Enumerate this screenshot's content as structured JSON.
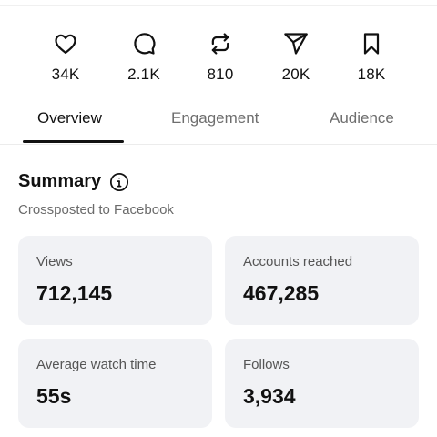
{
  "engagement_stats": [
    {
      "icon": "heart-icon",
      "value": "34K"
    },
    {
      "icon": "comment-icon",
      "value": "2.1K"
    },
    {
      "icon": "repost-icon",
      "value": "810"
    },
    {
      "icon": "share-icon",
      "value": "20K"
    },
    {
      "icon": "bookmark-icon",
      "value": "18K"
    }
  ],
  "tabs": [
    {
      "label": "Overview",
      "active": true
    },
    {
      "label": "Engagement",
      "active": false
    },
    {
      "label": "Audience",
      "active": false
    }
  ],
  "summary": {
    "title": "Summary",
    "info_icon": "info-icon",
    "subtitle": "Crossposted to Facebook",
    "cards": [
      {
        "label": "Views",
        "value": "712,145"
      },
      {
        "label": "Accounts reached",
        "value": "467,285"
      },
      {
        "label": "Average watch time",
        "value": "55s"
      },
      {
        "label": "Follows",
        "value": "3,934"
      }
    ]
  },
  "colors": {
    "text_primary": "#111111",
    "text_secondary": "#6b6b6b",
    "card_background": "#f1f2f5",
    "tab_indicator": "#111111"
  }
}
